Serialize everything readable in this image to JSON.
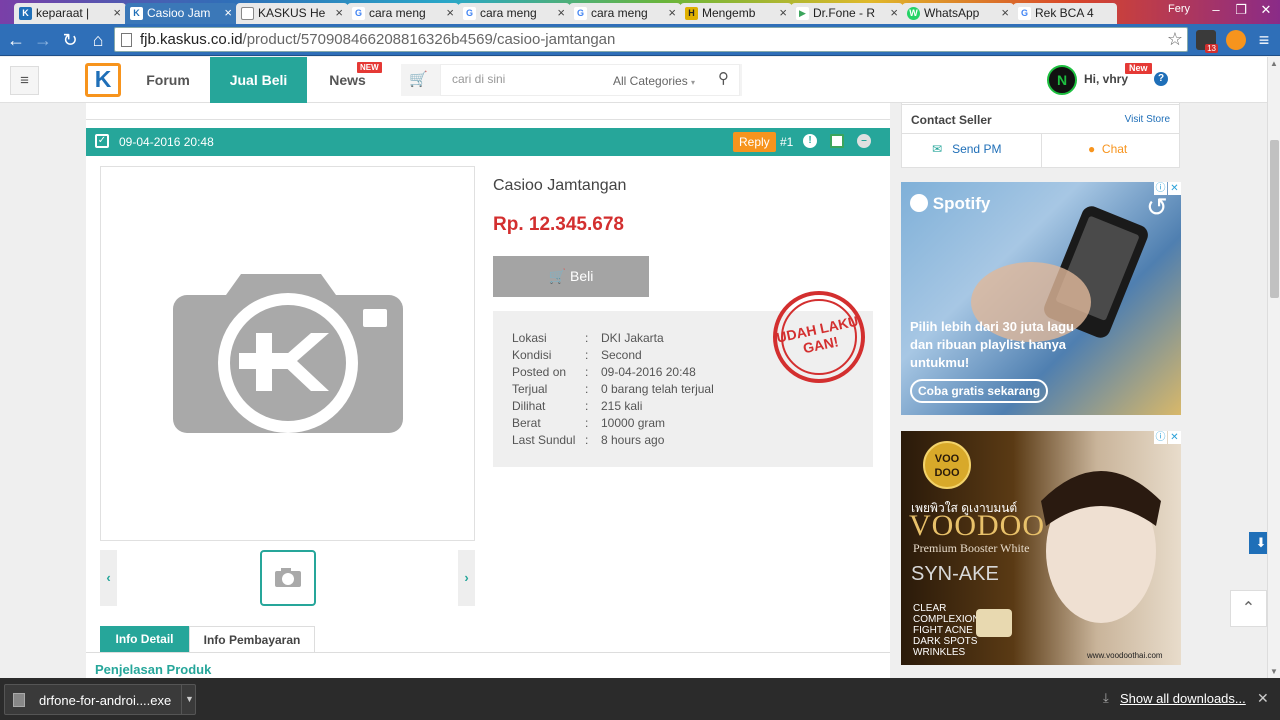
{
  "browser": {
    "tabs": [
      {
        "title": "keparaat |",
        "favicon": "K",
        "color": "#1f6fb8"
      },
      {
        "title": "Casioo Jam",
        "favicon": "K",
        "color": "#1f6fb8",
        "active": true
      },
      {
        "title": "KASKUS He",
        "favicon": "",
        "color": "#999999"
      },
      {
        "title": "cara meng",
        "favicon": "G",
        "color": "#4285f4"
      },
      {
        "title": "cara meng",
        "favicon": "G",
        "color": "#4285f4"
      },
      {
        "title": "cara meng",
        "favicon": "G",
        "color": "#4285f4"
      },
      {
        "title": "Mengemb",
        "favicon": "H",
        "color": "#e0b000"
      },
      {
        "title": "Dr.Fone - R",
        "favicon": "▶",
        "color": "#3ba55c"
      },
      {
        "title": "WhatsApp",
        "favicon": "W",
        "color": "#25d366"
      },
      {
        "title": "Rek BCA 4",
        "favicon": "G",
        "color": "#4285f4"
      }
    ],
    "close_glyph": "×",
    "user": "Fery",
    "url_host": "fjb.kaskus.co.id",
    "url_path": "/product/570908466208816326b4569/casioo-jamtangan",
    "extension_badge": "13"
  },
  "site": {
    "logo_letter": "K",
    "nav": {
      "forum": "Forum",
      "jualbeli": "Jual Beli",
      "news": "News",
      "news_badge": "NEW"
    },
    "search": {
      "placeholder": "cari di sini",
      "category": "All Categories"
    },
    "user_greeting": "Hi, vhry",
    "user_badge": "New",
    "help": "?"
  },
  "post": {
    "date": "09-04-2016 20:48",
    "reply": "Reply",
    "number": "#1",
    "title": "Casioo Jamtangan",
    "price": "Rp. 12.345.678",
    "buy_label": "Beli",
    "details": [
      {
        "key": "Lokasi",
        "value": "DKI Jakarta"
      },
      {
        "key": "Kondisi",
        "value": "Second"
      },
      {
        "key": "Posted on",
        "value": "09-04-2016 20:48"
      },
      {
        "key": "Terjual",
        "value": "0 barang telah terjual"
      },
      {
        "key": "Dilihat",
        "value": "215 kali"
      },
      {
        "key": "Berat",
        "value": "10000 gram"
      },
      {
        "key": "Last Sundul",
        "value": "8 hours ago"
      }
    ],
    "stamp_line1": "UDAH LAKU",
    "stamp_line2": "GAN!",
    "tabs": {
      "detail": "Info Detail",
      "payment": "Info Pembayaran"
    },
    "section_title": "Penjelasan Produk"
  },
  "sidebar": {
    "contact_title": "Contact Seller",
    "visit_store": "Visit Store",
    "send_pm": "Send PM",
    "chat": "Chat",
    "ad1": {
      "brand": "Spotify",
      "headline": "Pilih lebih dari 30 juta lagu dan ribuan playlist hanya untukmu!",
      "cta": "Coba gratis sekarang"
    },
    "ad2": {
      "logo": "VOO DOO",
      "thai": "เพยพิวใส ดูเงาบมนต์",
      "brand": "VOODOO",
      "sub": "Premium Booster White",
      "ingredient": "SYN-AKE",
      "claims": [
        "CLEAR",
        "COMPLEXION",
        "FIGHT ACNE",
        "DARK SPOTS",
        "WRINKLES"
      ],
      "site": "www.voodoothai.com"
    }
  },
  "downloads": {
    "file": "drfone-for-androi....exe",
    "show_all": "Show all downloads..."
  },
  "colors": {
    "teal": "#26a69a",
    "price_red": "#d32f2f",
    "reply_orange": "#f7941d",
    "kaskus_blue": "#1f6fb8"
  }
}
